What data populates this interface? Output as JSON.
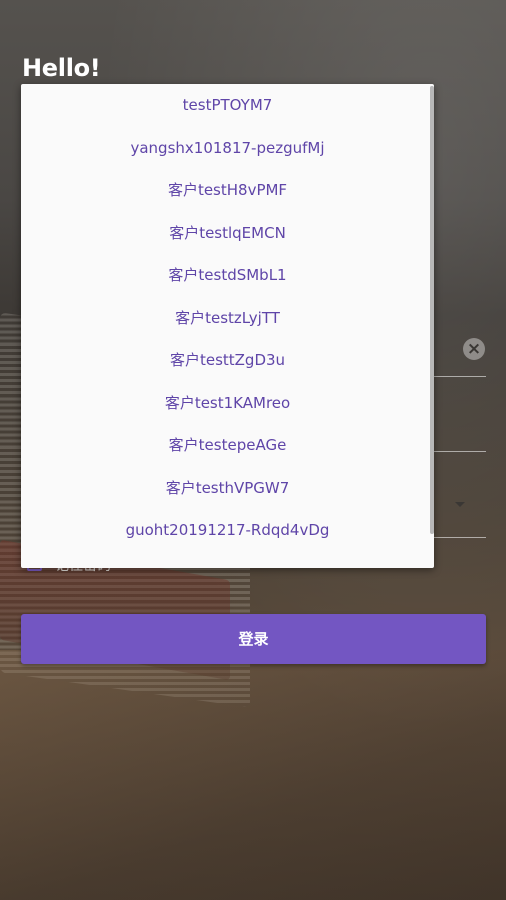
{
  "header": {
    "greeting": "Hello!"
  },
  "form": {
    "clear_icon": "close-icon",
    "clear_symbol": "×",
    "dropdown_icon": "chevron-down-icon"
  },
  "remember": {
    "label": "记住密码"
  },
  "login": {
    "label": "登录",
    "color": "#7356c2"
  },
  "popup": {
    "items": [
      "testPTOYM7",
      "yangshx101817-pezgufMj",
      "客户testH8vPMF",
      "客户testlqEMCN",
      "客户testdSMbL1",
      "客户testzLyjTT",
      "客户testtZgD3u",
      "客户test1KAMreo",
      "客户testepeAGe",
      "客户testhVPGW7",
      "guoht20191217-Rdqd4vDg"
    ]
  },
  "colors": {
    "accent": "#7356c2",
    "item_text": "#5f45a8",
    "popup_bg": "#fafafa"
  }
}
